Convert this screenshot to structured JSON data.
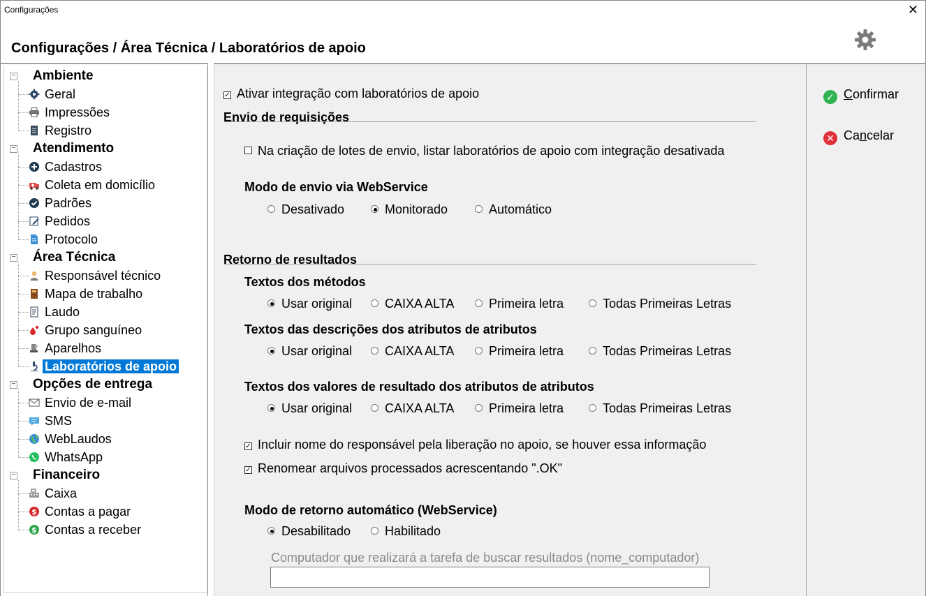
{
  "window": {
    "title": "Configurações",
    "close_glyph": "✕"
  },
  "header": {
    "breadcrumb": "Configurações / Área Técnica / Laboratórios de apoio",
    "gear_icon": "gear-icon"
  },
  "sidebar": {
    "groups": [
      {
        "label": "Ambiente",
        "items": [
          {
            "label": "Geral",
            "icon": "gear-icon"
          },
          {
            "label": "Impressões",
            "icon": "printer-icon"
          },
          {
            "label": "Registro",
            "icon": "document-icon"
          }
        ]
      },
      {
        "label": "Atendimento",
        "items": [
          {
            "label": "Cadastros",
            "icon": "plus-circle-icon"
          },
          {
            "label": "Coleta em domicílio",
            "icon": "ambulance-icon"
          },
          {
            "label": "Padrões",
            "icon": "check-circle-icon"
          },
          {
            "label": "Pedidos",
            "icon": "edit-icon"
          },
          {
            "label": "Protocolo",
            "icon": "file-icon"
          }
        ]
      },
      {
        "label": "Área Técnica",
        "items": [
          {
            "label": "Responsável técnico",
            "icon": "person-icon"
          },
          {
            "label": "Mapa de trabalho",
            "icon": "book-icon"
          },
          {
            "label": "Laudo",
            "icon": "report-icon"
          },
          {
            "label": "Grupo sanguíneo",
            "icon": "blood-drop-icon"
          },
          {
            "label": "Aparelhos",
            "icon": "device-icon"
          },
          {
            "label": "Laboratórios de apoio",
            "icon": "microscope-icon",
            "selected": true
          }
        ]
      },
      {
        "label": "Opções de entrega",
        "items": [
          {
            "label": "Envio de e-mail",
            "icon": "mail-icon"
          },
          {
            "label": "SMS",
            "icon": "sms-icon"
          },
          {
            "label": "WebLaudos",
            "icon": "globe-icon"
          },
          {
            "label": "WhatsApp",
            "icon": "whatsapp-icon"
          }
        ]
      },
      {
        "label": "Financeiro",
        "items": [
          {
            "label": "Caixa",
            "icon": "cash-register-icon"
          },
          {
            "label": "Contas a pagar",
            "icon": "dollar-red-icon"
          },
          {
            "label": "Contas a receber",
            "icon": "dollar-green-icon"
          }
        ]
      }
    ]
  },
  "main": {
    "enable_integration": {
      "label": "Ativar integração com laboratórios de apoio",
      "checked": true
    },
    "envio": {
      "title": "Envio de requisições",
      "list_disabled": {
        "label": "Na criação de lotes de envio, listar laboratórios de apoio com integração desativada",
        "checked": false
      },
      "mode_title": "Modo de envio via  WebService",
      "mode_options": [
        "Desativado",
        "Monitorado",
        "Automático"
      ],
      "mode_selected": "Monitorado"
    },
    "retorno": {
      "title": "Retorno de resultados",
      "case_options": [
        "Usar original",
        "CAIXA ALTA",
        "Primeira letra",
        "Todas Primeiras Letras"
      ],
      "metodos_title": "Textos dos métodos",
      "metodos_selected": "Usar original",
      "descricoes_title": "Textos das descrições dos atributos de atributos",
      "descricoes_selected": "Usar original",
      "valores_title": "Textos dos valores de resultado dos atributos de atributos",
      "valores_selected": "Usar original",
      "include_responsible": {
        "label": "Incluir nome do responsável pela liberação no apoio, se houver essa informação",
        "checked": true
      },
      "rename_files": {
        "label": "Renomear arquivos processados acrescentando \".OK\"",
        "checked": true
      },
      "auto_title": "Modo de retorno automático (WebService)",
      "auto_options": [
        "Desabilitado",
        "Habilitado"
      ],
      "auto_selected": "Desabilitado",
      "computer_label": "Computador que realizará a tarefa de buscar resultados (nome_computador)",
      "computer_value": ""
    }
  },
  "actions": {
    "confirm": {
      "prefix": "",
      "underline": "C",
      "rest": "onfirmar",
      "color": "#2fb350"
    },
    "cancel": {
      "prefix": "Ca",
      "underline": "n",
      "rest": "celar",
      "color": "#e0303a"
    }
  }
}
